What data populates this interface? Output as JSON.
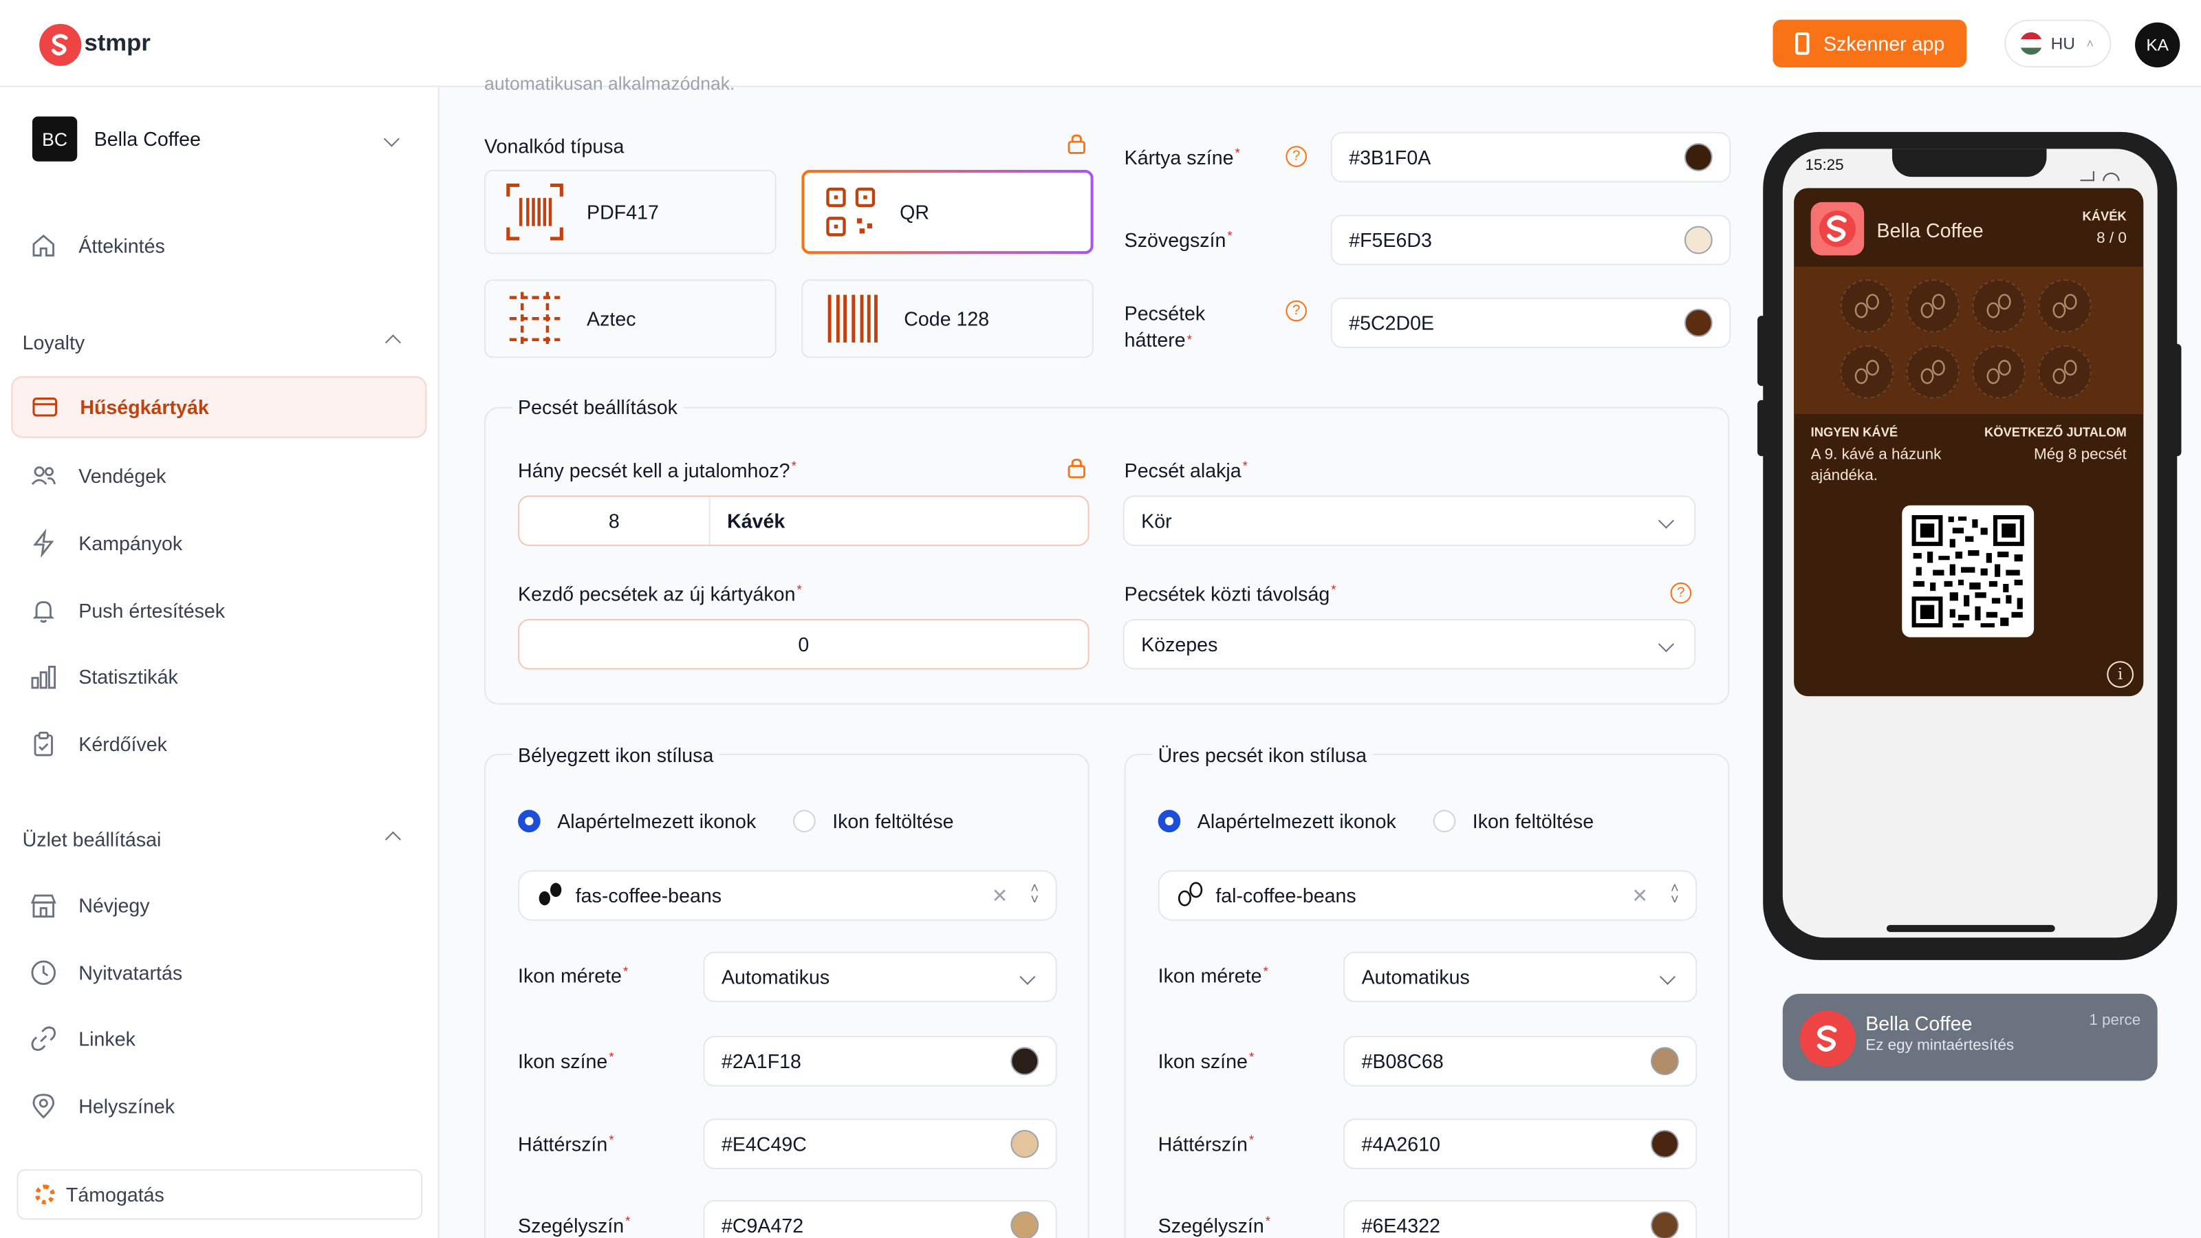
{
  "header": {
    "logo_text": "stmpr",
    "scanner_button": "Szkenner app",
    "lang": "HU",
    "avatar": "KA"
  },
  "sidebar": {
    "business": {
      "initials": "BC",
      "name": "Bella Coffee"
    },
    "overview": "Áttekintés",
    "loyalty_label": "Loyalty",
    "loyalty_items": [
      "Hűségkártyák",
      "Vendégek",
      "Kampányok",
      "Push értesítések",
      "Statisztikák",
      "Kérdőívek"
    ],
    "store_label": "Üzlet beállításai",
    "store_items": [
      "Névjegy",
      "Nyitvatartás",
      "Linkek",
      "Helyszínek"
    ],
    "support": "Támogatás"
  },
  "main": {
    "intro_text": "automatikusan alkalmazódnak.",
    "barcode_type_label": "Vonalkód típusa",
    "barcode_types": [
      "PDF417",
      "QR",
      "Aztec",
      "Code 128"
    ],
    "colors": {
      "card_color_label": "Kártya színe",
      "card_color_value": "#3B1F0A",
      "text_color_label": "Szövegszín",
      "text_color_value": "#F5E6D3",
      "stamps_bg_label_1": "Pecsétek",
      "stamps_bg_label_2": "háttere",
      "stamps_bg_value": "#5C2D0E"
    },
    "stamp_settings": {
      "title": "Pecsét beállítások",
      "count_label": "Hány pecsét kell a jutalomhoz?",
      "count_value": "8",
      "count_unit": "Kávék",
      "shape_label": "Pecsét alakja",
      "shape_value": "Kör",
      "initial_label": "Kezdő pecsétek az új kártyákon",
      "initial_value": "0",
      "spacing_label": "Pecsétek közti távolság",
      "spacing_value": "Közepes"
    },
    "stamped_icon": {
      "title": "Bélyegzett ikon stílusa",
      "radio_default": "Alapértelmezett ikonok",
      "radio_upload": "Ikon feltöltése",
      "icon_value": "fas-coffee-beans",
      "size_label": "Ikon mérete",
      "size_value": "Automatikus",
      "icon_color_label": "Ikon színe",
      "icon_color_value": "#2A1F18",
      "bg_label": "Háttérszín",
      "bg_value": "#E4C49C",
      "border_label": "Szegélyszín",
      "border_value": "#C9A472"
    },
    "empty_icon": {
      "title": "Üres pecsét ikon stílusa",
      "radio_default": "Alapértelmezett ikonok",
      "radio_upload": "Ikon feltöltése",
      "icon_value": "fal-coffee-beans",
      "size_label": "Ikon mérete",
      "size_value": "Automatikus",
      "icon_color_label": "Ikon színe",
      "icon_color_value": "#B08C68",
      "bg_label": "Háttérszín",
      "bg_value": "#4A2610",
      "border_label": "Szegélyszín",
      "border_value": "#6E4322"
    }
  },
  "preview": {
    "time": "15:25",
    "card_name": "Bella Coffee",
    "counter_label": "KÁVÉK",
    "counter_value": "8 / 0",
    "reward_label": "INGYEN KÁVÉ",
    "reward_text_1": "A 9. kávé a házunk",
    "reward_text_2": "ajándéka.",
    "next_label": "KÖVETKEZŐ JUTALOM",
    "next_text": "Még 8 pecsét",
    "notification_title": "Bella Coffee",
    "notification_body": "Ez egy mintaértesítés",
    "notification_time": "1 perce"
  }
}
